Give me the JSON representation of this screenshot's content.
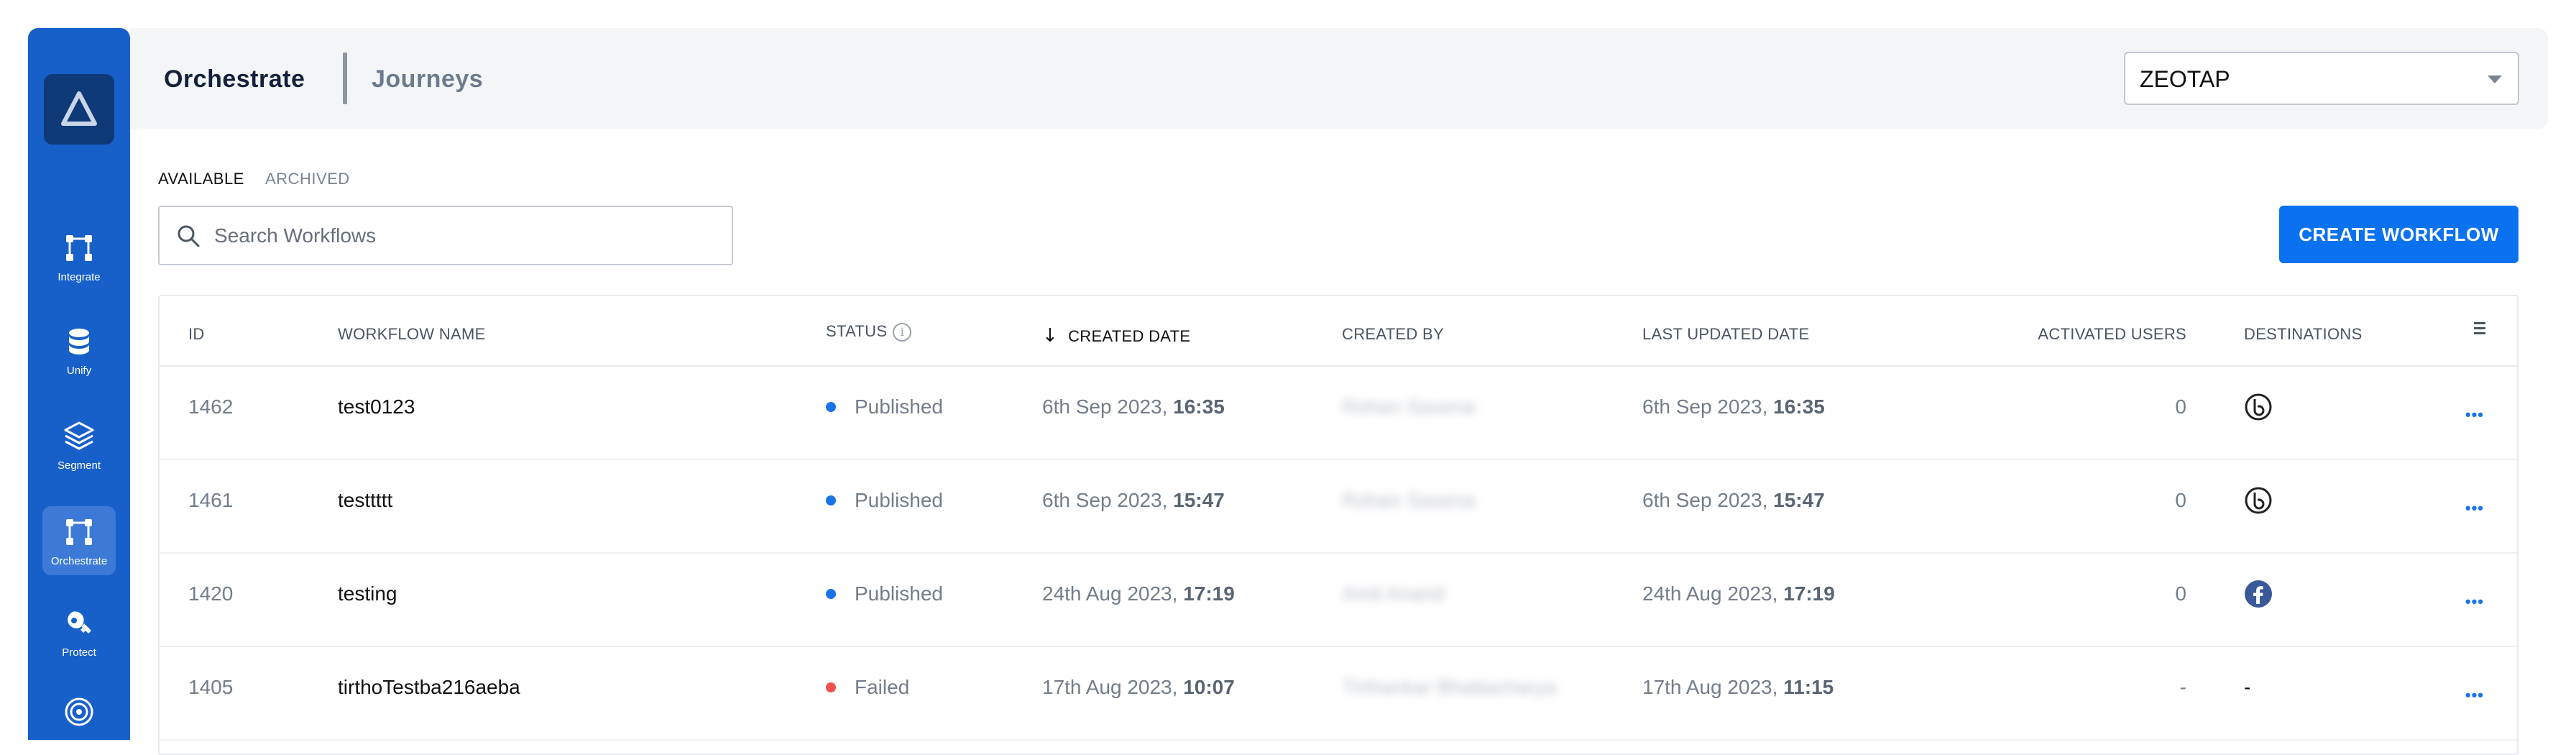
{
  "sidebar": {
    "items": [
      {
        "label": "Integrate",
        "icon": "integrate-icon"
      },
      {
        "label": "Unify",
        "icon": "database-icon"
      },
      {
        "label": "Segment",
        "icon": "layers-icon"
      },
      {
        "label": "Orchestrate",
        "icon": "orchestrate-icon",
        "active": true
      },
      {
        "label": "Protect",
        "icon": "protect-icon"
      },
      {
        "label": "",
        "icon": "target-icon"
      }
    ]
  },
  "header": {
    "title": "Orchestrate",
    "subtitle": "Journeys",
    "org_select": {
      "value": "ZEOTAP"
    }
  },
  "tabs": {
    "available": "AVAILABLE",
    "archived": "ARCHIVED"
  },
  "search": {
    "placeholder": "Search Workflows"
  },
  "create_button": "CREATE WORKFLOW",
  "table": {
    "columns": {
      "id": "ID",
      "name": "WORKFLOW NAME",
      "status": "STATUS",
      "created": "CREATED DATE",
      "created_by": "CREATED BY",
      "updated": "LAST UPDATED DATE",
      "activated": "ACTIVATED USERS",
      "destinations": "DESTINATIONS"
    },
    "sort_indicator": "↓",
    "rows": [
      {
        "id": "1462",
        "name": "test0123",
        "status": "Published",
        "status_color": "#1a73e8",
        "created_date": "6th Sep 2023, ",
        "created_time": "16:35",
        "created_by": "Rohan Saxena",
        "updated_date": "6th Sep 2023, ",
        "updated_time": "16:35",
        "activated": "0",
        "destination": "bluecore-icon",
        "more": "•••"
      },
      {
        "id": "1461",
        "name": "testtttt",
        "status": "Published",
        "status_color": "#1a73e8",
        "created_date": "6th Sep 2023, ",
        "created_time": "15:47",
        "created_by": "Rohan Saxena",
        "updated_date": "6th Sep 2023, ",
        "updated_time": "15:47",
        "activated": "0",
        "destination": "bluecore-icon",
        "more": "•••"
      },
      {
        "id": "1420",
        "name": "testing",
        "status": "Published",
        "status_color": "#1a73e8",
        "created_date": "24th Aug 2023, ",
        "created_time": "17:19",
        "created_by": "Amit Anand",
        "updated_date": "24th Aug 2023, ",
        "updated_time": "17:19",
        "activated": "0",
        "destination": "facebook-icon",
        "more": "•••"
      },
      {
        "id": "1405",
        "name": "tirthoTestba216aeba",
        "status": "Failed",
        "status_color": "#f0524f",
        "created_date": "17th Aug 2023, ",
        "created_time": "10:07",
        "created_by": "Tirthankar Bhattacharya",
        "updated_date": "17th Aug 2023, ",
        "updated_time": "11:15",
        "activated": "-",
        "destination_text": "-",
        "more": "•••"
      }
    ]
  }
}
